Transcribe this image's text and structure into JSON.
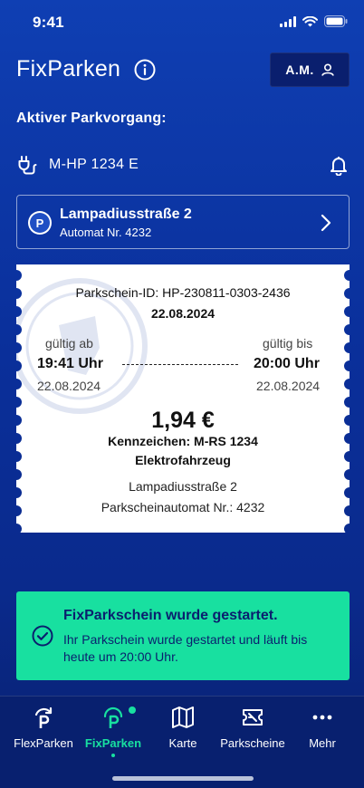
{
  "status_bar": {
    "time": "9:41"
  },
  "header": {
    "app_title": "FixParken",
    "user_initials": "A.M."
  },
  "active_session": {
    "section_title": "Aktiver Parkvorgang:",
    "vehicle_plate": "M-HP 1234 E",
    "location": {
      "badge": "P",
      "name": "Lampadiusstraße 2",
      "automat": "Automat Nr. 4232"
    }
  },
  "ticket": {
    "id_line": "Parkschein-ID: HP-230811-0303-2436",
    "date": "22.08.2024",
    "valid_from": {
      "label": "gültig ab",
      "time": "19:41 Uhr",
      "date": "22.08.2024"
    },
    "valid_to": {
      "label": "gültig bis",
      "time": "20:00 Uhr",
      "date": "22.08.2024"
    },
    "price": "1,94 €",
    "plate_line": "Kennzeichen: M-RS 1234",
    "vehicle_type": "Elektrofahrzeug",
    "street": "Lampadiusstraße 2",
    "automat_line": "Parkscheinautomat Nr.: 4232"
  },
  "success": {
    "title": "FixParkschein wurde gestartet.",
    "message": "Ihr Parkschein wurde gestartet und läuft bis heute um 20:00 Uhr."
  },
  "nav": {
    "items": [
      {
        "label": "FlexParken",
        "icon": "flexparken-icon"
      },
      {
        "label": "FixParken",
        "icon": "fixparken-icon",
        "active": true
      },
      {
        "label": "Karte",
        "icon": "map-icon"
      },
      {
        "label": "Parkscheine",
        "icon": "ticket-icon"
      },
      {
        "label": "Mehr",
        "icon": "more-icon"
      }
    ]
  },
  "colors": {
    "accent": "#18e0a0",
    "background": "#0a2f9a",
    "nav_bg": "#08206f"
  }
}
